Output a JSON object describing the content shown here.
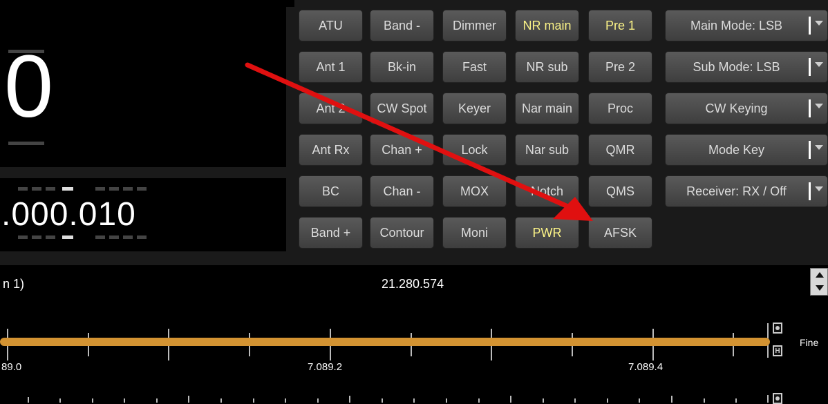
{
  "display": {
    "main_digit": "0",
    "sub_frequency": ".000.010",
    "center_freq": "21.280.574",
    "left_label": "n 1)"
  },
  "buttons": {
    "col1": [
      "ATU",
      "Ant 1",
      "Ant 2",
      "Ant Rx",
      "BC",
      "Band +"
    ],
    "col2": [
      "Band -",
      "Bk-in",
      "CW Spot",
      "Chan +",
      "Chan -",
      "Contour"
    ],
    "col3": [
      "Dimmer",
      "Fast",
      "Keyer",
      "Lock",
      "MOX",
      "Moni"
    ],
    "col4": [
      "NR main",
      "NR sub",
      "Nar main",
      "Nar sub",
      "Notch",
      "PWR"
    ],
    "col5": [
      "Pre 1",
      "Pre 2",
      "Proc",
      "QMR",
      "QMS",
      "AFSK"
    ]
  },
  "dropdowns": [
    "Main Mode: LSB",
    "Sub Mode: LSB",
    "CW Keying",
    "Mode Key",
    "Receiver: RX / Off"
  ],
  "scale": {
    "labels": [
      "89.0",
      "7.089.2",
      "7.089.4"
    ],
    "fine_label": "Fine",
    "h_label": "H"
  },
  "colors": {
    "active_text": "#fbf387",
    "slider": "#d39332",
    "arrow": "#e01010"
  }
}
